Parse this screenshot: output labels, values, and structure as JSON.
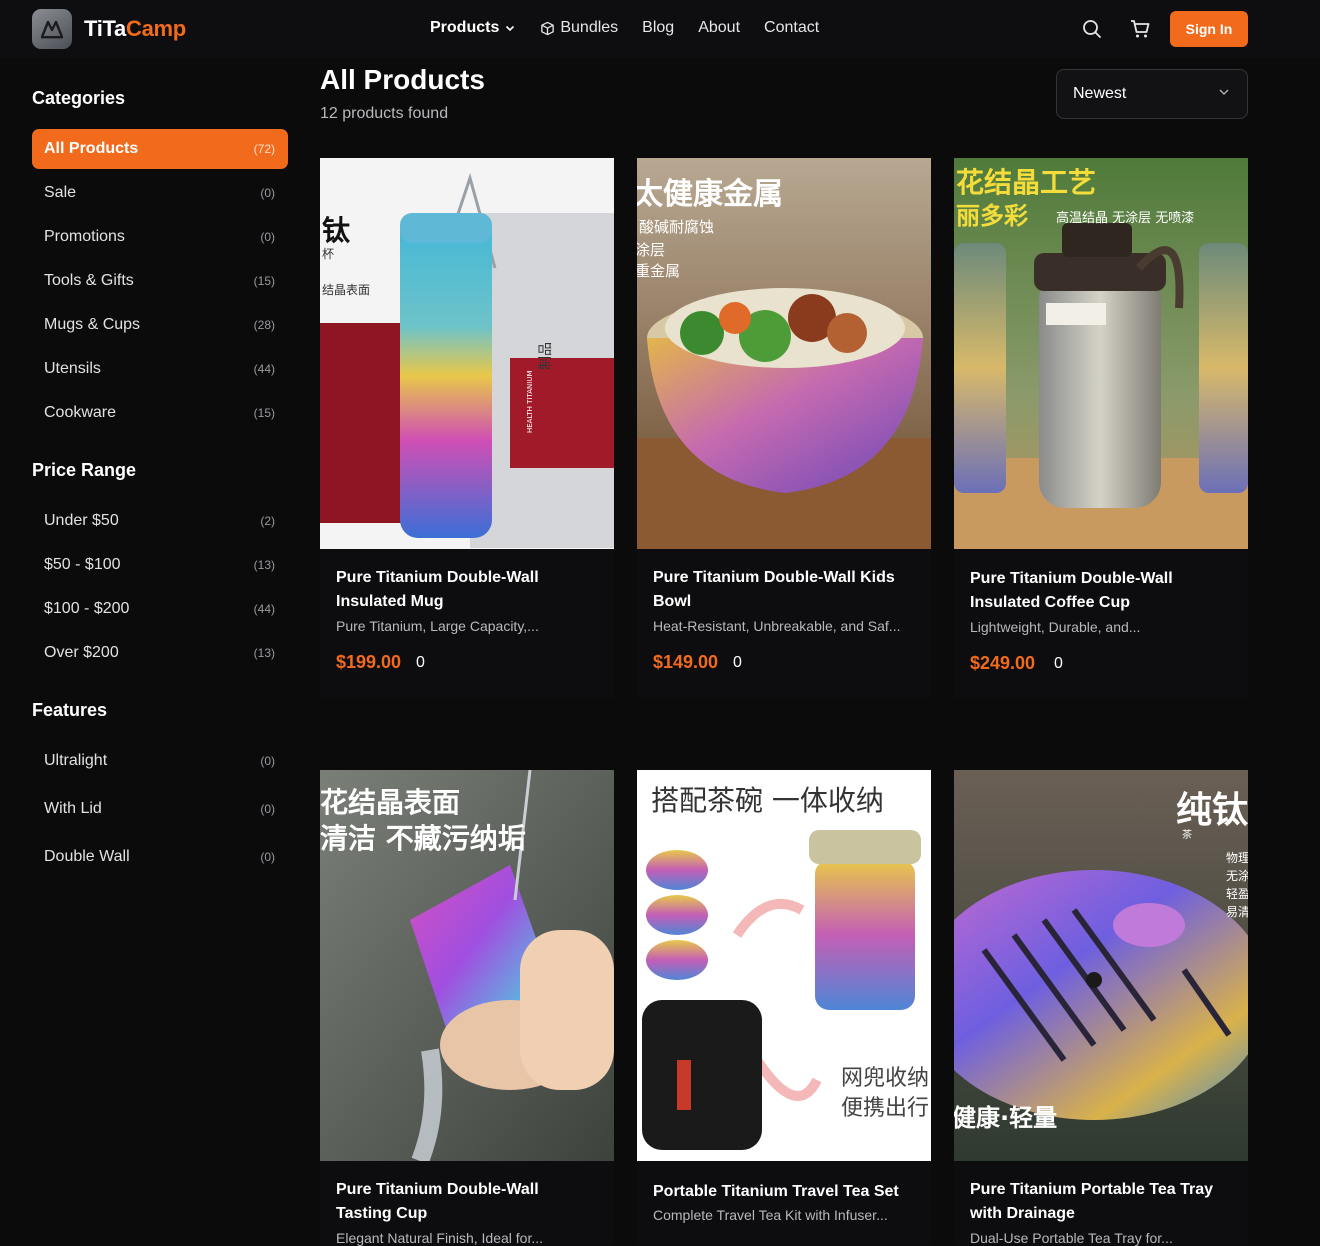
{
  "brand": {
    "name_part1": "TiTa",
    "name_part2": "Camp"
  },
  "nav": {
    "products": "Products",
    "bundles": "Bundles",
    "blog": "Blog",
    "about": "About",
    "contact": "Contact",
    "sign_in": "Sign In"
  },
  "sidebar": {
    "categories_title": "Categories",
    "categories": [
      {
        "label": "All Products",
        "count": "(72)"
      },
      {
        "label": "Sale",
        "count": "(0)"
      },
      {
        "label": "Promotions",
        "count": "(0)"
      },
      {
        "label": "Tools & Gifts",
        "count": "(15)"
      },
      {
        "label": "Mugs & Cups",
        "count": "(28)"
      },
      {
        "label": "Utensils",
        "count": "(44)"
      },
      {
        "label": "Cookware",
        "count": "(15)"
      }
    ],
    "price_title": "Price Range",
    "prices": [
      {
        "label": "Under $50",
        "count": "(2)"
      },
      {
        "label": "$50 - $100",
        "count": "(13)"
      },
      {
        "label": "$100 - $200",
        "count": "(44)"
      },
      {
        "label": "Over $200",
        "count": "(13)"
      }
    ],
    "features_title": "Features",
    "features": [
      {
        "label": "Ultralight",
        "count": "(0)"
      },
      {
        "label": "With Lid",
        "count": "(0)"
      },
      {
        "label": "Double Wall",
        "count": "(0)"
      }
    ]
  },
  "main": {
    "title": "All Products",
    "found": "12 products found",
    "sort_value": "Newest"
  },
  "products": [
    {
      "title": "Pure Titanium Double-Wall Insulated Mug",
      "desc": "Pure Titanium, Large Capacity,...",
      "price": "$199.00",
      "sold": "0",
      "img_text": [
        "钛",
        "杯",
        "结晶表面",
        "HEALTH TITANIUM",
        "制品"
      ]
    },
    {
      "title": "Pure Titanium Double-Wall Kids Bowl",
      "desc": "Heat-Resistant, Unbreakable, and Saf...",
      "price": "$149.00",
      "sold": "0",
      "img_text": [
        "太健康金属",
        "酸碱耐腐蚀",
        "涂层",
        "重金属"
      ]
    },
    {
      "title": "Pure Titanium Double-Wall Insulated Coffee Cup",
      "desc": "Lightweight, Durable, and...",
      "price": "$249.00",
      "sold": "0",
      "img_text": [
        "花结晶工艺",
        "丽多彩",
        "高温结晶 无涂层 无喷漆"
      ]
    },
    {
      "title": "Pure Titanium Double-Wall Tasting Cup",
      "desc": "Elegant Natural Finish, Ideal for...",
      "price": "",
      "sold": "",
      "img_text": [
        "花结晶表面",
        "清洁 不藏污纳垢"
      ]
    },
    {
      "title": "Portable Titanium Travel Tea Set",
      "desc": "Complete Travel Tea Kit with Infuser...",
      "price": "",
      "sold": "",
      "img_text": [
        "搭配茶碗 一体收纳",
        "网兜收纳",
        "便携出行"
      ]
    },
    {
      "title": "Pure Titanium Portable Tea Tray with Drainage",
      "desc": "Dual-Use Portable Tea Tray for...",
      "price": "",
      "sold": "",
      "img_text": [
        "纯钛",
        "茶",
        "健康·轻量",
        "物理",
        "无涂",
        "轻盈",
        "易清"
      ]
    }
  ]
}
